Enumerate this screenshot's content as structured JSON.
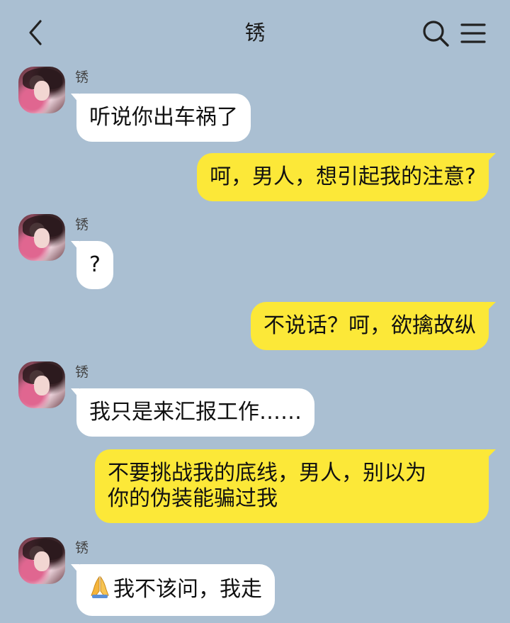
{
  "header": {
    "title": "锈",
    "back_icon": "chevron-left-icon",
    "search_icon": "search-icon",
    "menu_icon": "menu-icon"
  },
  "contact": {
    "name": "锈"
  },
  "messages": [
    {
      "side": "left",
      "sender": "锈",
      "text": "听说你出车祸了"
    },
    {
      "side": "right",
      "text": "呵，男人，想引起我的注意?"
    },
    {
      "side": "left",
      "sender": "锈",
      "text": "?"
    },
    {
      "side": "right",
      "text": "不说话？呵，欲擒故纵"
    },
    {
      "side": "left",
      "sender": "锈",
      "text": "我只是来汇报工作……"
    },
    {
      "side": "right",
      "lines": [
        "不要挑战我的底线，男人，别以为",
        "你的伪装能骗过我"
      ]
    },
    {
      "side": "left",
      "sender": "锈",
      "emoji": "folded-hands-icon",
      "text": "我不该问，我走"
    }
  ],
  "colors": {
    "background": "#aabfd2",
    "incoming_bubble": "#ffffff",
    "outgoing_bubble": "#fce838"
  }
}
